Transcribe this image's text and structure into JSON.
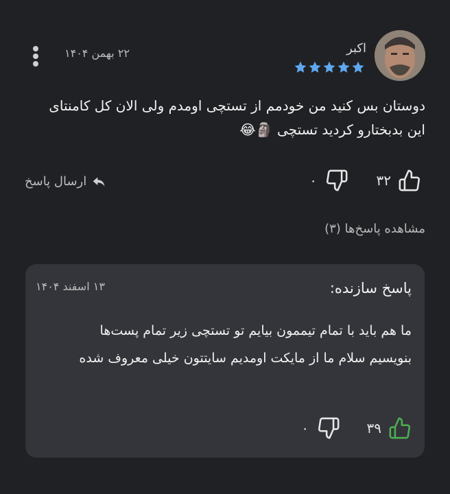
{
  "comment": {
    "username": "اکبر",
    "date": "۲۲ بهمن ۱۴۰۴",
    "rating": 5,
    "text": "دوستان بس کنید من خودمم از تستچی اومدم ولی الان کل کامنتای این بدبختارو کردید تستچی 🗿😂",
    "likes": "۳۲",
    "dislikes": "۰",
    "reply_label": "ارسال پاسخ",
    "view_replies": "مشاهده پاسخ‌ها (۳)"
  },
  "maker_reply": {
    "title": "پاسخ سازنده:",
    "date": "۱۳ اسفند ۱۴۰۴",
    "text": "ما هم باید با تمام تیممون بیایم تو تستچی زیر تمام پست‌ها بنویسیم سلام ما از مایکت اومدیم سایتتون خیلی معروف شده",
    "likes": "۳۹",
    "dislikes": "۰"
  },
  "colors": {
    "background": "#202125",
    "card": "#34353a",
    "star": "#5fa8f0",
    "reply_like": "#4caf50"
  }
}
